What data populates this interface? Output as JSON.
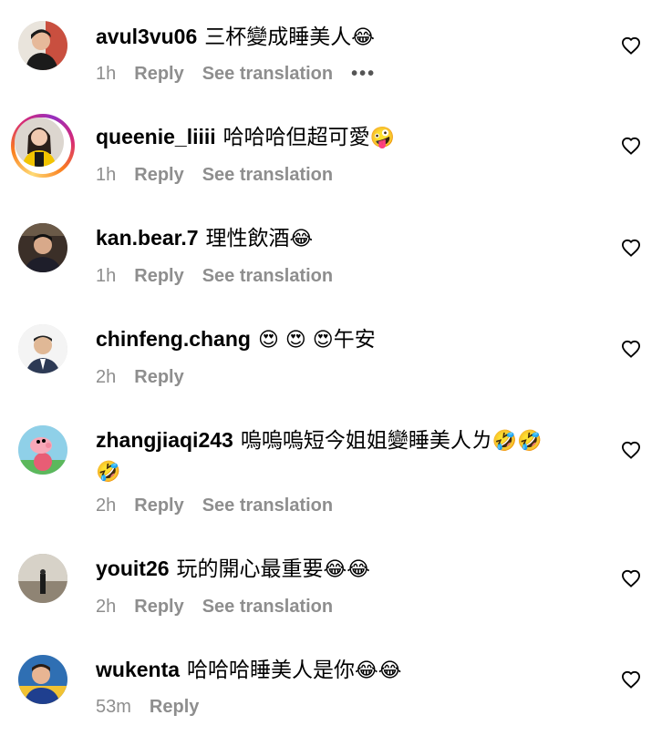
{
  "comments": [
    {
      "username": "avul3vu06",
      "text": "三杯變成睡美人",
      "emoji": "😂",
      "time": "1h",
      "reply_label": "Reply",
      "translation_label": "See translation",
      "more_label": "•••"
    },
    {
      "username": "queenie_liiii",
      "text": "哈哈哈但超可愛",
      "emoji": "🤪",
      "time": "1h",
      "reply_label": "Reply",
      "translation_label": "See translation"
    },
    {
      "username": "kan.bear.7",
      "text": "理性飲酒",
      "emoji": "😂",
      "time": "1h",
      "reply_label": "Reply",
      "translation_label": "See translation"
    },
    {
      "username": "chinfeng.chang",
      "text_prefix": "😍 😍 😍",
      "text": "午安",
      "time": "2h",
      "reply_label": "Reply"
    },
    {
      "username": "zhangjiaqi243",
      "text": "嗚嗚嗚短今姐姐變睡美人ㄌ",
      "emoji": "🤣🤣",
      "emoji_line2": "🤣",
      "time": "2h",
      "reply_label": "Reply",
      "translation_label": "See translation"
    },
    {
      "username": "youit26",
      "text": "玩的開心最重要",
      "emoji": "😂😂",
      "time": "2h",
      "reply_label": "Reply",
      "translation_label": "See translation"
    },
    {
      "username": "wukenta",
      "text": "哈哈哈睡美人是你",
      "emoji": "😂😂",
      "time": "53m",
      "reply_label": "Reply"
    }
  ],
  "colors": {
    "meta_gray": "#8e8e8e",
    "story_ring": [
      "#feda75",
      "#fa7e1e",
      "#d62976",
      "#962fbf"
    ]
  },
  "icons": {
    "like": "heart-outline-icon",
    "more": "more-dots-icon"
  }
}
